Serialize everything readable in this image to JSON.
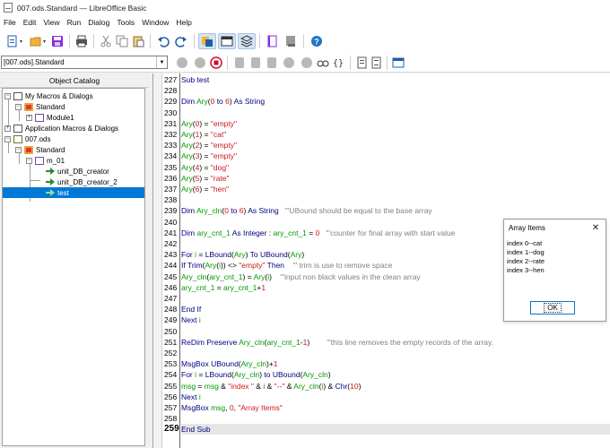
{
  "window": {
    "title": "007.ods.Standard — LibreOffice Basic"
  },
  "menu": [
    "File",
    "Edit",
    "View",
    "Run",
    "Dialog",
    "Tools",
    "Window",
    "Help"
  ],
  "library_select": {
    "value": "[007.ods].Standard"
  },
  "catalog": {
    "title": "Object Catalog",
    "tree": [
      {
        "label": "My Macros & Dialogs",
        "expander": "−"
      },
      {
        "label": "Standard",
        "expander": "−"
      },
      {
        "label": "Module1",
        "expander": "+"
      },
      {
        "label": "Application Macros & Dialogs",
        "expander": "+"
      },
      {
        "label": "007.ods",
        "expander": "−"
      },
      {
        "label": "Standard",
        "expander": "−"
      },
      {
        "label": "m_01",
        "expander": "−"
      },
      {
        "label": "unit_DB_creator",
        "expander": ""
      },
      {
        "label": "unit_DB_creator_2",
        "expander": ""
      },
      {
        "label": "test",
        "expander": ""
      }
    ]
  },
  "editor": {
    "line_numbers": [
      "227",
      "228",
      "229",
      "230",
      "231",
      "232",
      "233",
      "234",
      "235",
      "236",
      "237",
      "238",
      "239",
      "240",
      "241",
      "242",
      "243",
      "244",
      "245",
      "246",
      "247",
      "248",
      "249",
      "250",
      "251",
      "252",
      "253",
      "254",
      "255",
      "256",
      "257",
      "258",
      "259"
    ],
    "lines": [
      [
        {
          "t": "kw",
          "v": "Sub "
        },
        {
          "t": "kw",
          "v": "test"
        }
      ],
      [],
      [
        {
          "t": "kw",
          "v": "Dim "
        },
        {
          "t": "id",
          "v": "Ary"
        },
        {
          "t": "op",
          "v": "("
        },
        {
          "t": "num",
          "v": "0"
        },
        {
          "t": "kw",
          "v": " to "
        },
        {
          "t": "num",
          "v": "6"
        },
        {
          "t": "op",
          "v": ") "
        },
        {
          "t": "kw",
          "v": "As String"
        }
      ],
      [],
      [
        {
          "t": "id",
          "v": "Ary"
        },
        {
          "t": "op",
          "v": "("
        },
        {
          "t": "num",
          "v": "0"
        },
        {
          "t": "op",
          "v": ") = "
        },
        {
          "t": "str",
          "v": "\"empty\""
        }
      ],
      [
        {
          "t": "id",
          "v": "Ary"
        },
        {
          "t": "op",
          "v": "("
        },
        {
          "t": "num",
          "v": "1"
        },
        {
          "t": "op",
          "v": ") = "
        },
        {
          "t": "str",
          "v": "\"cat\""
        }
      ],
      [
        {
          "t": "id",
          "v": "Ary"
        },
        {
          "t": "op",
          "v": "("
        },
        {
          "t": "num",
          "v": "2"
        },
        {
          "t": "op",
          "v": ") = "
        },
        {
          "t": "str",
          "v": "\"empty\""
        }
      ],
      [
        {
          "t": "id",
          "v": "Ary"
        },
        {
          "t": "op",
          "v": "("
        },
        {
          "t": "num",
          "v": "3"
        },
        {
          "t": "op",
          "v": ") = "
        },
        {
          "t": "str",
          "v": "\"empty\""
        }
      ],
      [
        {
          "t": "id",
          "v": "Ary"
        },
        {
          "t": "op",
          "v": "("
        },
        {
          "t": "num",
          "v": "4"
        },
        {
          "t": "op",
          "v": ") = "
        },
        {
          "t": "str",
          "v": "\"dog\""
        }
      ],
      [
        {
          "t": "id",
          "v": "Ary"
        },
        {
          "t": "op",
          "v": "("
        },
        {
          "t": "num",
          "v": "5"
        },
        {
          "t": "op",
          "v": ") = "
        },
        {
          "t": "str",
          "v": "\"rate\""
        }
      ],
      [
        {
          "t": "id",
          "v": "Ary"
        },
        {
          "t": "op",
          "v": "("
        },
        {
          "t": "num",
          "v": "6"
        },
        {
          "t": "op",
          "v": ") = "
        },
        {
          "t": "str",
          "v": "\"hen\""
        }
      ],
      [],
      [
        {
          "t": "kw",
          "v": "Dim "
        },
        {
          "t": "id",
          "v": "Ary_cln"
        },
        {
          "t": "op",
          "v": "("
        },
        {
          "t": "num",
          "v": "0"
        },
        {
          "t": "kw",
          "v": " to "
        },
        {
          "t": "num",
          "v": "6"
        },
        {
          "t": "op",
          "v": ") "
        },
        {
          "t": "kw",
          "v": "As String"
        },
        {
          "t": "cm",
          "v": "   '\"UBound should be equal to the base array"
        }
      ],
      [],
      [
        {
          "t": "kw",
          "v": "Dim "
        },
        {
          "t": "id",
          "v": "ary_cnt_1"
        },
        {
          "t": "kw",
          "v": " As Integer"
        },
        {
          "t": "op",
          "v": " : "
        },
        {
          "t": "id",
          "v": "ary_cnt_1"
        },
        {
          "t": "op",
          "v": " = "
        },
        {
          "t": "num",
          "v": "0"
        },
        {
          "t": "cm",
          "v": "   '\"counter for final array with start value"
        }
      ],
      [],
      [
        {
          "t": "kw",
          "v": "For "
        },
        {
          "t": "id",
          "v": "i"
        },
        {
          "t": "op",
          "v": " = "
        },
        {
          "t": "kw",
          "v": "LBound"
        },
        {
          "t": "op",
          "v": "("
        },
        {
          "t": "id",
          "v": "Ary"
        },
        {
          "t": "op",
          "v": ") "
        },
        {
          "t": "kw",
          "v": "To "
        },
        {
          "t": "kw",
          "v": "UBound"
        },
        {
          "t": "op",
          "v": "("
        },
        {
          "t": "id",
          "v": "Ary"
        },
        {
          "t": "op",
          "v": ")"
        }
      ],
      [
        {
          "t": "kw",
          "v": "If "
        },
        {
          "t": "kw",
          "v": "Trim"
        },
        {
          "t": "op",
          "v": "("
        },
        {
          "t": "id",
          "v": "Ary"
        },
        {
          "t": "op",
          "v": "("
        },
        {
          "t": "id",
          "v": "i"
        },
        {
          "t": "op",
          "v": ")) <> "
        },
        {
          "t": "str",
          "v": "\"empty\""
        },
        {
          "t": "kw",
          "v": " Then"
        },
        {
          "t": "cm",
          "v": "    '\" trim is use to remove space"
        }
      ],
      [
        {
          "t": "id",
          "v": "Ary_cln"
        },
        {
          "t": "op",
          "v": "("
        },
        {
          "t": "id",
          "v": "ary_cnt_1"
        },
        {
          "t": "op",
          "v": ") = "
        },
        {
          "t": "id",
          "v": "Ary"
        },
        {
          "t": "op",
          "v": "("
        },
        {
          "t": "id",
          "v": "i"
        },
        {
          "t": "op",
          "v": ")"
        },
        {
          "t": "cm",
          "v": "    '\"input non black values in the clean array"
        }
      ],
      [
        {
          "t": "id",
          "v": "ary_cnt_1"
        },
        {
          "t": "op",
          "v": " = "
        },
        {
          "t": "id",
          "v": "ary_cnt_1"
        },
        {
          "t": "op",
          "v": "+"
        },
        {
          "t": "num",
          "v": "1"
        }
      ],
      [],
      [
        {
          "t": "kw",
          "v": "End If"
        }
      ],
      [
        {
          "t": "kw",
          "v": "Next "
        },
        {
          "t": "id",
          "v": "i"
        }
      ],
      [],
      [
        {
          "t": "kw",
          "v": "ReDim Preserve "
        },
        {
          "t": "id",
          "v": "Ary_cln"
        },
        {
          "t": "op",
          "v": "("
        },
        {
          "t": "id",
          "v": "ary_cnt_1"
        },
        {
          "t": "op",
          "v": "-"
        },
        {
          "t": "num",
          "v": "1"
        },
        {
          "t": "op",
          "v": ")"
        },
        {
          "t": "cm",
          "v": "        '\"this line removes the empty records of the array."
        }
      ],
      [],
      [
        {
          "t": "kw",
          "v": "MsgBox "
        },
        {
          "t": "kw",
          "v": "UBound"
        },
        {
          "t": "op",
          "v": "("
        },
        {
          "t": "id",
          "v": "Ary_cln"
        },
        {
          "t": "op",
          "v": ")+"
        },
        {
          "t": "num",
          "v": "1"
        }
      ],
      [
        {
          "t": "kw",
          "v": "For "
        },
        {
          "t": "id",
          "v": "i"
        },
        {
          "t": "op",
          "v": " = "
        },
        {
          "t": "kw",
          "v": "LBound"
        },
        {
          "t": "op",
          "v": "("
        },
        {
          "t": "id",
          "v": "Ary_cln"
        },
        {
          "t": "op",
          "v": ") "
        },
        {
          "t": "kw",
          "v": "to "
        },
        {
          "t": "kw",
          "v": "UBound"
        },
        {
          "t": "op",
          "v": "("
        },
        {
          "t": "id",
          "v": "Ary_cln"
        },
        {
          "t": "op",
          "v": ")"
        }
      ],
      [
        {
          "t": "id",
          "v": "msg"
        },
        {
          "t": "op",
          "v": " = "
        },
        {
          "t": "id",
          "v": "msg"
        },
        {
          "t": "op",
          "v": " & "
        },
        {
          "t": "str",
          "v": "\"index \""
        },
        {
          "t": "op",
          "v": " & "
        },
        {
          "t": "id",
          "v": "i"
        },
        {
          "t": "op",
          "v": " & "
        },
        {
          "t": "str",
          "v": "\"--\""
        },
        {
          "t": "op",
          "v": " & "
        },
        {
          "t": "id",
          "v": "Ary_cln"
        },
        {
          "t": "op",
          "v": "("
        },
        {
          "t": "id",
          "v": "i"
        },
        {
          "t": "op",
          "v": ") & "
        },
        {
          "t": "kw",
          "v": "Chr"
        },
        {
          "t": "op",
          "v": "("
        },
        {
          "t": "num",
          "v": "10"
        },
        {
          "t": "op",
          "v": ")"
        }
      ],
      [
        {
          "t": "kw",
          "v": "Next "
        },
        {
          "t": "id",
          "v": "i"
        }
      ],
      [
        {
          "t": "kw",
          "v": "MsgBox "
        },
        {
          "t": "id",
          "v": "msg"
        },
        {
          "t": "op",
          "v": ", "
        },
        {
          "t": "num",
          "v": "0"
        },
        {
          "t": "op",
          "v": ", "
        },
        {
          "t": "str",
          "v": "\"Array Items\""
        }
      ],
      [],
      [
        {
          "t": "kw",
          "v": "End Sub"
        }
      ]
    ]
  },
  "msgbox": {
    "title": "Array Items",
    "close": "✕",
    "lines": [
      "index 0--cat",
      "index 1--dog",
      "index 2--rate",
      "index 3--hen"
    ],
    "ok_label": "OK"
  }
}
